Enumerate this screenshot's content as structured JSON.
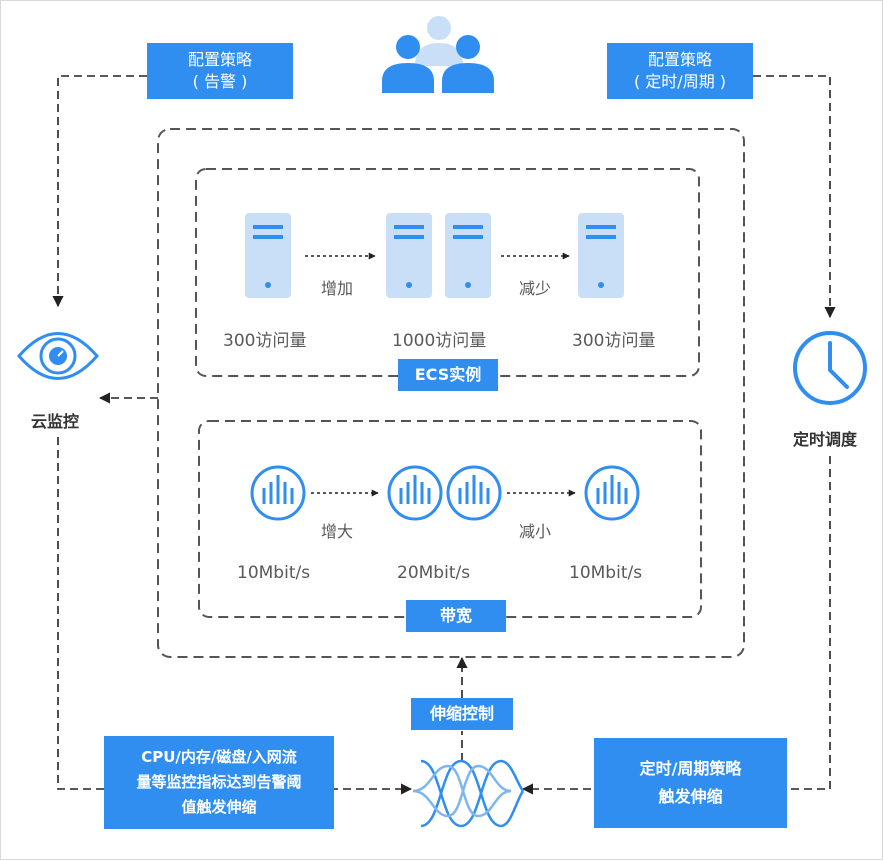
{
  "policy_alarm": {
    "line1": "配置策略",
    "line2": "( 告警 )"
  },
  "policy_schedule": {
    "line1": "配置策略",
    "line2": "( 定时/周期 )"
  },
  "ecs": {
    "title": "ECS实例",
    "increase_label": "增加",
    "decrease_label": "减少",
    "states": [
      "300访问量",
      "1000访问量",
      "300访问量"
    ]
  },
  "bandwidth": {
    "title": "带宽",
    "increase_label": "增大",
    "decrease_label": "减小",
    "states": [
      "10Mbit/s",
      "20Mbit/s",
      "10Mbit/s"
    ]
  },
  "cloud_monitor": {
    "label": "云监控"
  },
  "scheduler": {
    "label": "定时调度"
  },
  "scaling_control": {
    "label": "伸缩控制"
  },
  "alarm_trigger": {
    "line1": "CPU/内存/磁盘/入网流",
    "line2": "量等监控指标达到告警阈",
    "line3": "值触发伸缩"
  },
  "schedule_trigger": {
    "line1": "定时/周期策略",
    "line2": "触发伸缩"
  },
  "colors": {
    "accent": "#2f8ef0",
    "server": "#c9dff7",
    "dash": "#555555"
  }
}
